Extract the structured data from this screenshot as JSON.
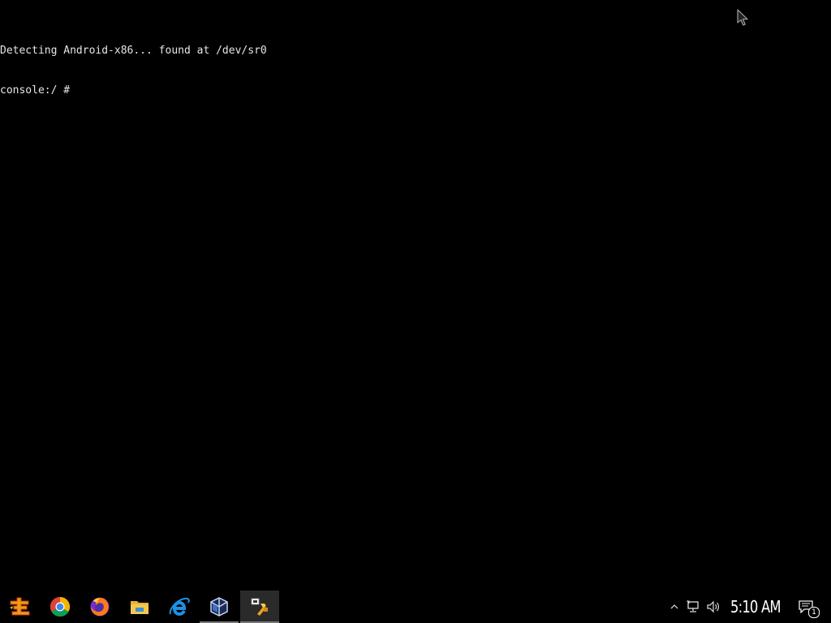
{
  "console": {
    "lines": [
      "Detecting Android-x86... found at /dev/sr0",
      "console:/ # "
    ]
  },
  "taskbar": {
    "apps": [
      {
        "name": "start-menu",
        "icon": "orange-start-icon",
        "running": false,
        "active": false
      },
      {
        "name": "chrome",
        "icon": "chrome-icon",
        "running": false,
        "active": false
      },
      {
        "name": "firefox",
        "icon": "firefox-icon",
        "running": false,
        "active": false
      },
      {
        "name": "file-explorer",
        "icon": "folder-icon",
        "running": false,
        "active": false
      },
      {
        "name": "internet-explorer",
        "icon": "ie-icon",
        "running": false,
        "active": false
      },
      {
        "name": "virtualbox",
        "icon": "virtualbox-icon",
        "running": true,
        "active": false
      },
      {
        "name": "mmc-tools",
        "icon": "tools-icon",
        "running": true,
        "active": true
      }
    ],
    "tray": {
      "clock": "5:10 AM",
      "notification_count": "1"
    }
  },
  "colors": {
    "background": "#000000",
    "console_text": "#e6e6e6",
    "taskbar": "#000000",
    "active_button": "#2a2a2a"
  }
}
